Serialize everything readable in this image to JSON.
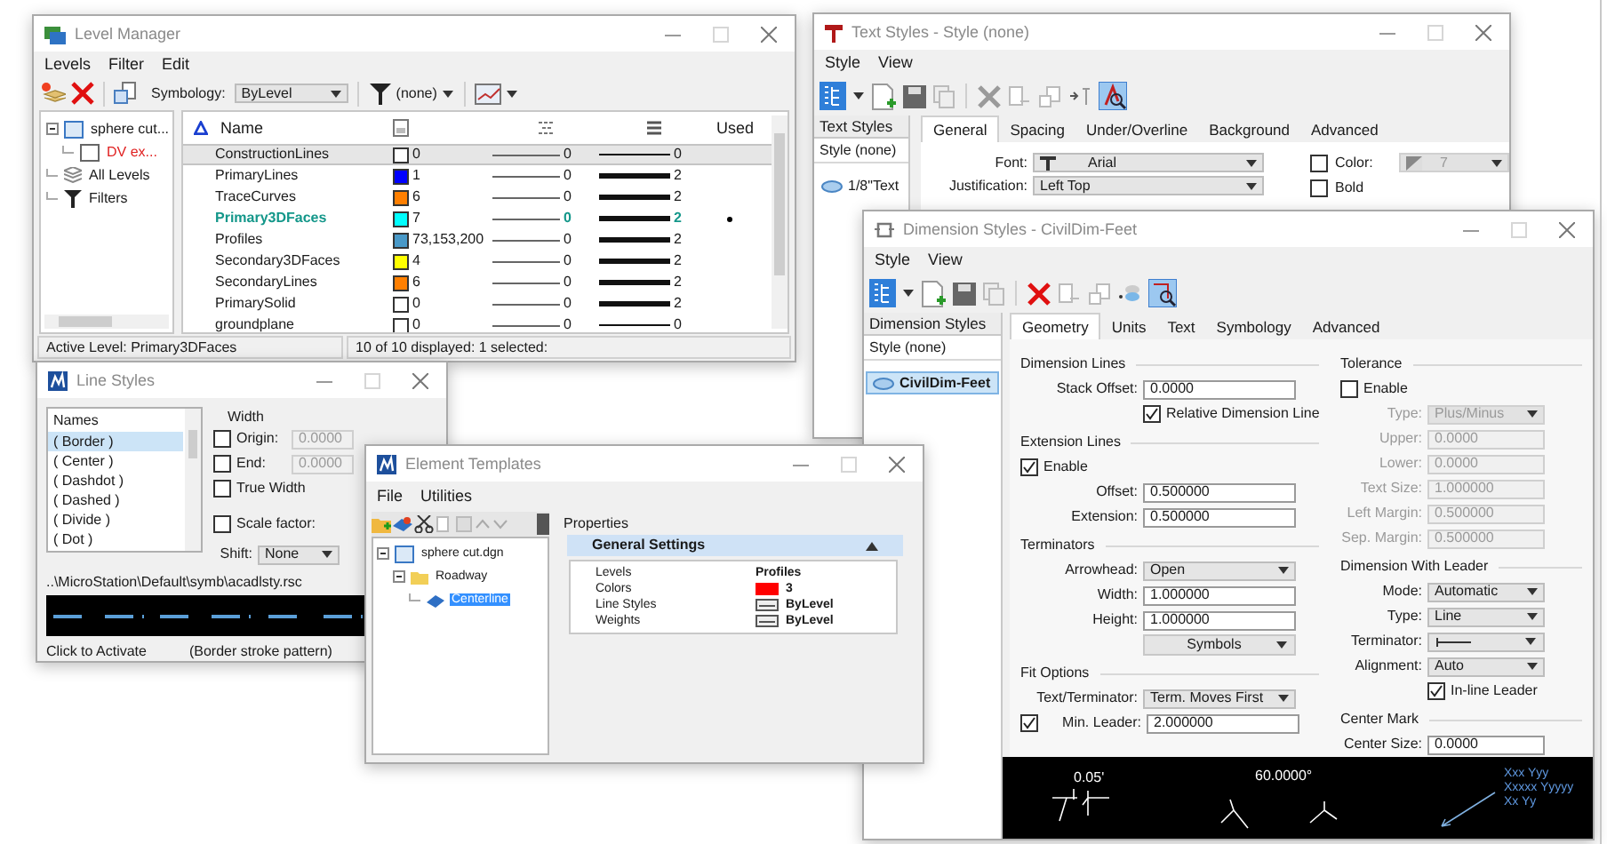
{
  "level_manager": {
    "title": "Level Manager",
    "menu": [
      "Levels",
      "Filter",
      "Edit"
    ],
    "symbology_label": "Symbology:",
    "symbology": "ByLevel",
    "filter": "(none)",
    "tree": [
      {
        "label": "sphere cut...",
        "kind": "file",
        "expanded": true,
        "children": [
          {
            "label": "DV ex...",
            "kind": "reference"
          }
        ]
      },
      {
        "label": "All Levels",
        "kind": "levels"
      },
      {
        "label": "Filters",
        "kind": "filters"
      }
    ],
    "columns": {
      "name": "Name",
      "used": "Used"
    },
    "rows": [
      {
        "name": "ConstructionLines",
        "color": "#ffffff",
        "color_number": "0",
        "style": "0",
        "weight": "0",
        "active": false,
        "used": false,
        "selected": true
      },
      {
        "name": "PrimaryLines",
        "color": "#0000ff",
        "color_number": "1",
        "style": "0",
        "weight": "2",
        "active": false,
        "used": false,
        "selected": false
      },
      {
        "name": "TraceCurves",
        "color": "#ff7f00",
        "color_number": "6",
        "style": "0",
        "weight": "2",
        "active": false,
        "used": false,
        "selected": false
      },
      {
        "name": "Primary3DFaces",
        "color": "#00ffff",
        "color_number": "7",
        "style": "0",
        "weight": "2",
        "active": true,
        "used": true,
        "selected": false
      },
      {
        "name": "Profiles",
        "color": "#4999c8",
        "color_number": "73,153,200",
        "style": "0",
        "weight": "2",
        "active": false,
        "used": false,
        "selected": false
      },
      {
        "name": "Secondary3DFaces",
        "color": "#ffff00",
        "color_number": "4",
        "style": "0",
        "weight": "2",
        "active": false,
        "used": false,
        "selected": false
      },
      {
        "name": "SecondaryLines",
        "color": "#ff7f00",
        "color_number": "6",
        "style": "0",
        "weight": "2",
        "active": false,
        "used": false,
        "selected": false
      },
      {
        "name": "PrimarySolid",
        "color": "#ffffff",
        "color_number": "0",
        "style": "0",
        "weight": "2",
        "active": false,
        "used": false,
        "selected": false
      },
      {
        "name": "groundplane",
        "color": "#ffffff",
        "color_number": "0",
        "style": "0",
        "weight": "0",
        "active": false,
        "used": false,
        "selected": false
      }
    ],
    "status": {
      "active_level": "Active Level: Primary3DFaces",
      "count": "10 of 10 displayed: 1 selected:"
    }
  },
  "line_styles": {
    "title": "Line Styles",
    "list_header": "Names",
    "names": [
      {
        "label": "( Border )",
        "selected": true
      },
      {
        "label": "( Center )",
        "selected": false
      },
      {
        "label": "( Dashdot )",
        "selected": false
      },
      {
        "label": "( Dashed )",
        "selected": false
      },
      {
        "label": "( Divide )",
        "selected": false
      },
      {
        "label": "( Dot )",
        "selected": false
      }
    ],
    "width_label": "Width",
    "width_rows": [
      {
        "kind": "field",
        "label": "Origin:",
        "checked": false,
        "value": "0.0000",
        "disabled": true
      },
      {
        "kind": "field",
        "label": "End:",
        "checked": false,
        "value": "0.0000",
        "disabled": true
      },
      {
        "kind": "check",
        "label": "True Width",
        "checked": false
      }
    ],
    "scale_factor": {
      "label": "Scale factor:",
      "checked": false
    },
    "shift": {
      "label": "Shift:",
      "value": "None"
    },
    "path": "..\\MicroStation\\Default\\symb\\acadlsty.rsc",
    "status": [
      "Click to Activate",
      "(Border stroke pattern)"
    ]
  },
  "element_templates": {
    "title": "Element Templates",
    "menu": [
      "File",
      "Utilities"
    ],
    "tree": [
      {
        "label": "sphere cut.dgn",
        "kind": "file",
        "expanded": true,
        "selected": false,
        "children": [
          {
            "label": "Roadway",
            "kind": "folder",
            "expanded": true,
            "selected": false,
            "children": [
              {
                "label": "Centerline",
                "kind": "template",
                "selected": true
              }
            ]
          }
        ]
      }
    ],
    "properties_label": "Properties",
    "section": {
      "title": "General Settings",
      "rows": [
        {
          "label": "Levels",
          "value": "Profiles",
          "kind": "text"
        },
        {
          "label": "Colors",
          "value": "3",
          "kind": "color",
          "color": "#ff0000"
        },
        {
          "label": "Line Styles",
          "value": "ByLevel",
          "kind": "style"
        },
        {
          "label": "Weights",
          "value": "ByLevel",
          "kind": "style"
        }
      ]
    }
  },
  "text_styles": {
    "title": "Text Styles - Style (none)",
    "menu": [
      "Style",
      "View"
    ],
    "list_header": "Text Styles",
    "items": [
      {
        "label": "Style (none)",
        "kind": "none",
        "selected": false
      },
      {
        "label": "1/8\"Text",
        "kind": "style",
        "selected": false
      }
    ],
    "tabs": [
      {
        "label": "General",
        "selected": true
      },
      {
        "label": "Spacing",
        "selected": false
      },
      {
        "label": "Under/Overline",
        "selected": false
      },
      {
        "label": "Background",
        "selected": false
      },
      {
        "label": "Advanced",
        "selected": false
      }
    ],
    "fields": [
      {
        "label": "Font:",
        "value": "Arial",
        "kind": "font"
      },
      {
        "label": "Justification:",
        "value": "Left Top",
        "kind": "dropdown"
      }
    ],
    "checks": [
      {
        "label": "Color:",
        "checked": false,
        "kind": "color",
        "value": "7"
      },
      {
        "label": "Bold",
        "checked": false,
        "kind": "plain"
      }
    ]
  },
  "dimension_styles": {
    "title": "Dimension Styles - CivilDim-Feet",
    "menu": [
      "Style",
      "View"
    ],
    "list_header": "Dimension Styles",
    "items": [
      {
        "label": "Style (none)",
        "kind": "none",
        "selected": false
      },
      {
        "label": "CivilDim-Feet",
        "kind": "style",
        "selected": true
      }
    ],
    "tabs": [
      {
        "label": "Geometry",
        "selected": true
      },
      {
        "label": "Units",
        "selected": false
      },
      {
        "label": "Text",
        "selected": false
      },
      {
        "label": "Symbology",
        "selected": false
      },
      {
        "label": "Advanced",
        "selected": false
      }
    ],
    "left": [
      {
        "kind": "section",
        "label": "Dimension Lines"
      },
      {
        "kind": "field",
        "label": "Stack Offset:",
        "value": "0.0000",
        "disabled": false
      },
      {
        "kind": "sub_check",
        "label": "Relative Dimension Line",
        "checked": true
      },
      {
        "kind": "section",
        "label": "Extension Lines"
      },
      {
        "kind": "check",
        "label": "Enable",
        "checked": true
      },
      {
        "kind": "field",
        "label": "Offset:",
        "value": "0.500000",
        "disabled": false
      },
      {
        "kind": "field",
        "label": "Extension:",
        "value": "0.500000",
        "disabled": false
      },
      {
        "kind": "section",
        "label": "Terminators"
      },
      {
        "kind": "dropdown",
        "label": "Arrowhead:",
        "value": "Open",
        "disabled": false
      },
      {
        "kind": "field",
        "label": "Width:",
        "value": "1.000000",
        "disabled": false
      },
      {
        "kind": "field",
        "label": "Height:",
        "value": "1.000000",
        "disabled": false
      },
      {
        "kind": "menu_button",
        "label": "Symbols"
      },
      {
        "kind": "section",
        "label": "Fit Options"
      },
      {
        "kind": "dropdown",
        "label": "Text/Terminator:",
        "value": "Term. Moves First",
        "disabled": false
      },
      {
        "kind": "check_field",
        "label": "Min. Leader:",
        "value": "2.000000",
        "checked": true
      }
    ],
    "right": [
      {
        "kind": "section",
        "label": "Tolerance"
      },
      {
        "kind": "check",
        "label": "Enable",
        "checked": false
      },
      {
        "kind": "dropdown",
        "label": "Type:",
        "value": "Plus/Minus",
        "disabled": true
      },
      {
        "kind": "field",
        "label": "Upper:",
        "value": "0.0000",
        "disabled": true
      },
      {
        "kind": "field",
        "label": "Lower:",
        "value": "0.0000",
        "disabled": true
      },
      {
        "kind": "field",
        "label": "Text Size:",
        "value": "1.000000",
        "disabled": true
      },
      {
        "kind": "field",
        "label": "Left Margin:",
        "value": "0.500000",
        "disabled": true
      },
      {
        "kind": "field",
        "label": "Sep. Margin:",
        "value": "0.500000",
        "disabled": true
      },
      {
        "kind": "section",
        "label": "Dimension With Leader"
      },
      {
        "kind": "dropdown",
        "label": "Mode:",
        "value": "Automatic",
        "disabled": false
      },
      {
        "kind": "dropdown",
        "label": "Type:",
        "value": "Line",
        "disabled": false
      },
      {
        "kind": "line_dropdown",
        "label": "Terminator:"
      },
      {
        "kind": "dropdown",
        "label": "Alignment:",
        "value": "Auto",
        "disabled": false
      },
      {
        "kind": "sub_check",
        "label": "In-line Leader",
        "checked": true
      },
      {
        "kind": "section",
        "label": "Center Mark"
      },
      {
        "kind": "field",
        "label": "Center Size:",
        "value": "0.0000",
        "disabled": false
      }
    ],
    "preview": {
      "linear": "0.05'",
      "angular": "60.0000°",
      "note": [
        "Xxx Yyy",
        "Xxxxx Yyyyy",
        "Xx Yy"
      ]
    }
  }
}
